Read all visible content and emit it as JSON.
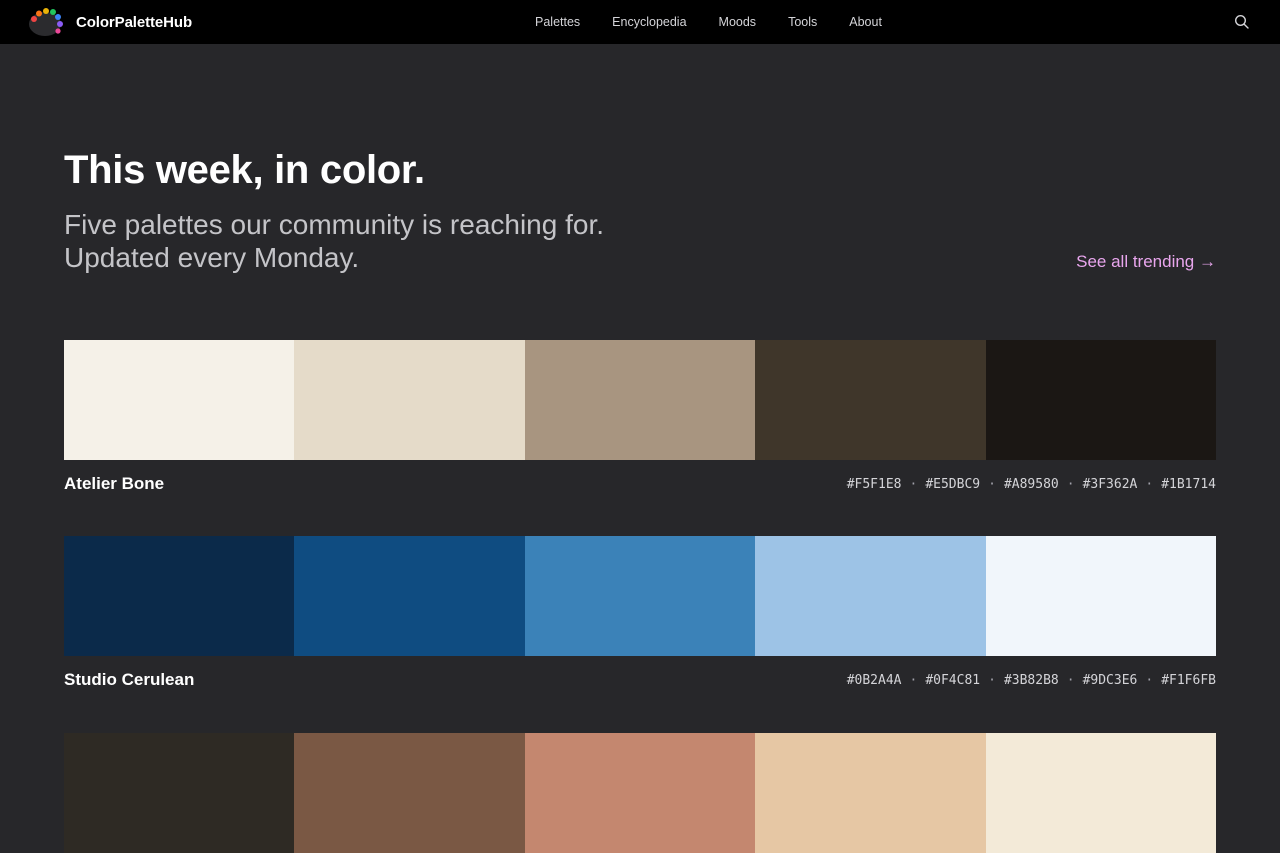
{
  "brand": {
    "name": "ColorPaletteHub"
  },
  "nav": {
    "items": [
      "Palettes",
      "Encyclopedia",
      "Moods",
      "Tools",
      "About"
    ]
  },
  "search": {
    "icon": "search-icon"
  },
  "hero": {
    "title": "This week, in color.",
    "subtitle": "Five palettes our community is reaching for. Updated every Monday.",
    "see_all": "See all trending →"
  },
  "colors": {
    "accent": "#E9A6EE",
    "background": "#27272A",
    "topbar": "#000000"
  },
  "palettes": [
    {
      "name": "Atelier Bone",
      "colors": [
        "#F5F1E8",
        "#E5DBC9",
        "#A89580",
        "#3F362A",
        "#1B1714"
      ],
      "hex_labels": [
        "#F5F1E8",
        "#E5DBC9",
        "#A89580",
        "#3F362A",
        "#1B1714"
      ],
      "separator": "·"
    },
    {
      "name": "Studio Cerulean",
      "colors": [
        "#0B2A4A",
        "#0F4C81",
        "#3B82B8",
        "#9DC3E6",
        "#F1F6FB"
      ],
      "hex_labels": [
        "#0B2A4A",
        "#0F4C81",
        "#3B82B8",
        "#9DC3E6",
        "#F1F6FB"
      ],
      "separator": "·"
    },
    {
      "colors": [
        "#2E2A24",
        "#7A5844",
        "#C4876F",
        "#E6C7A4",
        "#F3EAD8"
      ]
    }
  ]
}
